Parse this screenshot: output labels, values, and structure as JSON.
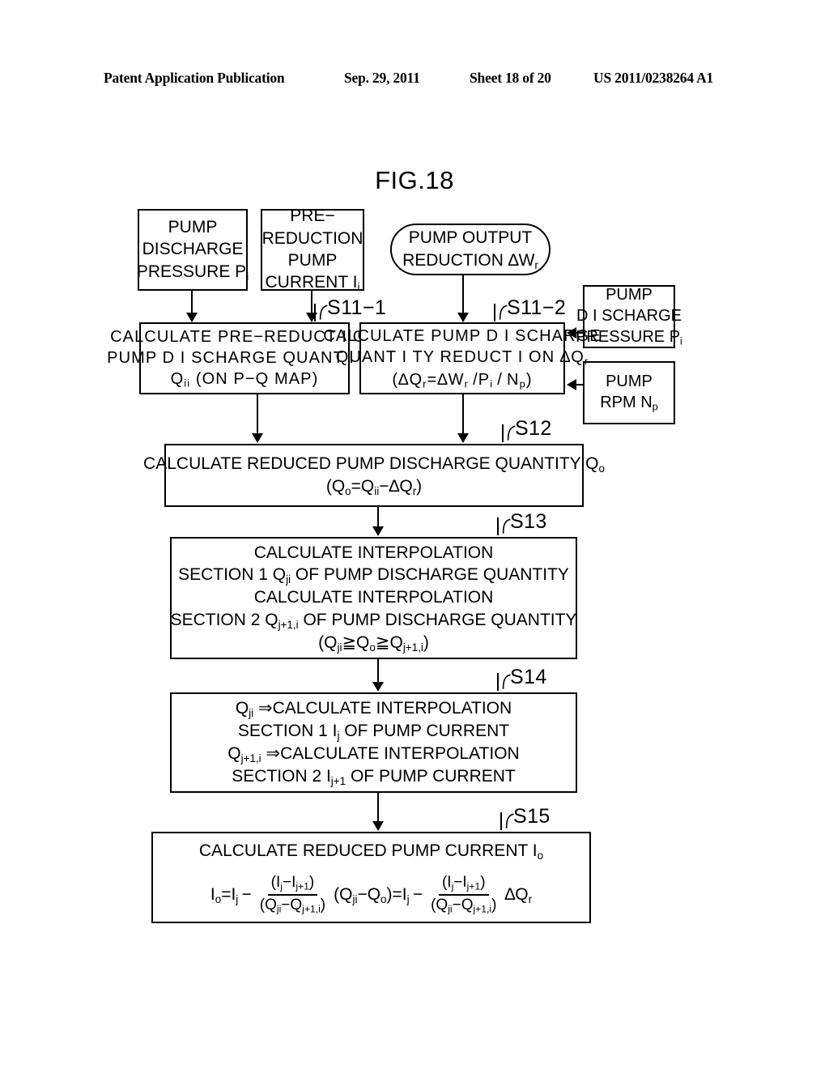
{
  "header": {
    "publication": "Patent Application Publication",
    "date": "Sep. 29, 2011",
    "sheet": "Sheet 18 of 20",
    "number": "US 2011/0238264 A1"
  },
  "figure": {
    "title": "FIG.18"
  },
  "nodes": {
    "pump_discharge_pressure": {
      "line1": "PUMP",
      "line2": "DISCHARGE",
      "line3_pre": "PRESSURE P",
      "line3_sub": "i"
    },
    "pre_reduction_pump_current": {
      "line1": "PRE−",
      "line2": "REDUCTION",
      "line3": "PUMP",
      "line4_pre": "CURRENT I",
      "line4_sub": "i"
    },
    "pump_output_reduction": {
      "line1": "PUMP OUTPUT",
      "line2_pre": "REDUCTION ∆W",
      "line2_sub": "r"
    },
    "pump_discharge_pressure_right": {
      "line1": "PUMP",
      "line2": "D I SCHARGE",
      "line3_pre": "PRESSURE P",
      "line3_sub": "i"
    },
    "pump_rpm_right": {
      "line1": "PUMP",
      "line2_pre": "RPM N",
      "line2_sub": "p"
    },
    "s11_1": {
      "label": "S11−1",
      "line1": "CALCULATE  PRE−REDUCT I ON",
      "line2": "PUMP  D I SCHARGE  QUANT I TY",
      "line3_pre": "Q",
      "line3_sub": "ii",
      "line3_post": " (ON P−Q MAP)"
    },
    "s11_2": {
      "label": "S11−2",
      "line1": "CALCULATE  PUMP  D I SCHARGE",
      "line2_pre": "QUANT I TY  REDUCT I ON  ∆Q",
      "line2_sub": "r",
      "line3": "(∆Q r =∆W r /P i / N p )"
    },
    "s12": {
      "label": "S12",
      "line1_pre": "CALCULATE REDUCED PUMP DISCHARGE QUANTITY Q",
      "line1_sub": "o",
      "line2": "(Q o =Q ii − ∆Q r )"
    },
    "s13": {
      "label": "S13",
      "line1": "CALCULATE INTERPOLATION",
      "line2_a": "SECTION 1 Q",
      "line2_sub": "ji",
      "line2_b": " OF PUMP DISCHARGE QUANTITY",
      "line3": "CALCULATE INTERPOLATION",
      "line4_a": "SECTION 2 Q",
      "line4_sub": "j+1,i",
      "line4_b": " OF PUMP DISCHARGE QUANTITY",
      "line5": "(Q ji ≧ Q o ≧ Q j+1,i )"
    },
    "s14": {
      "label": "S14",
      "line1_a": "Q",
      "line1_sub": "ji",
      "line1_b": " ⇒CALCULATE INTERPOLATION",
      "line2_a": "SECTION 1 I",
      "line2_sub": "j",
      "line2_b": " OF PUMP CURRENT",
      "line3_a": "Q",
      "line3_sub": "j+1,i",
      "line3_b": " ⇒CALCULATE INTERPOLATION",
      "line4_a": "SECTION 2 I",
      "line4_sub": "j+1",
      "line4_b": " OF PUMP CURRENT"
    },
    "s15": {
      "label": "S15",
      "title_pre": "CALCULATE REDUCED PUMP CURRENT I",
      "title_sub": "o",
      "formula": {
        "lhs": "I o =I j −",
        "frac1_num": "(I j −I j+1 )",
        "frac1_den": "(Q ji −Q j+1,i )",
        "mid": "(Q ji −Q o )=I j −",
        "frac2_num": "(I j −I j+1 )",
        "frac2_den": "(Q ji −Q j+1,i )",
        "rhs": "∆Q r"
      }
    }
  }
}
